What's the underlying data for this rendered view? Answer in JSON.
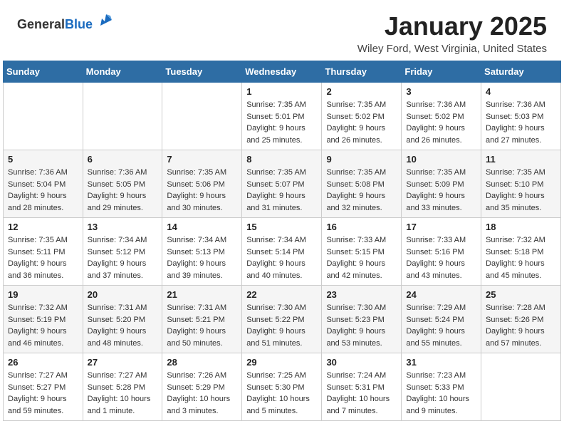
{
  "header": {
    "logo_general": "General",
    "logo_blue": "Blue",
    "title": "January 2025",
    "location": "Wiley Ford, West Virginia, United States"
  },
  "weekdays": [
    "Sunday",
    "Monday",
    "Tuesday",
    "Wednesday",
    "Thursday",
    "Friday",
    "Saturday"
  ],
  "weeks": [
    [
      {
        "day": "",
        "detail": ""
      },
      {
        "day": "",
        "detail": ""
      },
      {
        "day": "",
        "detail": ""
      },
      {
        "day": "1",
        "detail": "Sunrise: 7:35 AM\nSunset: 5:01 PM\nDaylight: 9 hours\nand 25 minutes."
      },
      {
        "day": "2",
        "detail": "Sunrise: 7:35 AM\nSunset: 5:02 PM\nDaylight: 9 hours\nand 26 minutes."
      },
      {
        "day": "3",
        "detail": "Sunrise: 7:36 AM\nSunset: 5:02 PM\nDaylight: 9 hours\nand 26 minutes."
      },
      {
        "day": "4",
        "detail": "Sunrise: 7:36 AM\nSunset: 5:03 PM\nDaylight: 9 hours\nand 27 minutes."
      }
    ],
    [
      {
        "day": "5",
        "detail": "Sunrise: 7:36 AM\nSunset: 5:04 PM\nDaylight: 9 hours\nand 28 minutes."
      },
      {
        "day": "6",
        "detail": "Sunrise: 7:36 AM\nSunset: 5:05 PM\nDaylight: 9 hours\nand 29 minutes."
      },
      {
        "day": "7",
        "detail": "Sunrise: 7:35 AM\nSunset: 5:06 PM\nDaylight: 9 hours\nand 30 minutes."
      },
      {
        "day": "8",
        "detail": "Sunrise: 7:35 AM\nSunset: 5:07 PM\nDaylight: 9 hours\nand 31 minutes."
      },
      {
        "day": "9",
        "detail": "Sunrise: 7:35 AM\nSunset: 5:08 PM\nDaylight: 9 hours\nand 32 minutes."
      },
      {
        "day": "10",
        "detail": "Sunrise: 7:35 AM\nSunset: 5:09 PM\nDaylight: 9 hours\nand 33 minutes."
      },
      {
        "day": "11",
        "detail": "Sunrise: 7:35 AM\nSunset: 5:10 PM\nDaylight: 9 hours\nand 35 minutes."
      }
    ],
    [
      {
        "day": "12",
        "detail": "Sunrise: 7:35 AM\nSunset: 5:11 PM\nDaylight: 9 hours\nand 36 minutes."
      },
      {
        "day": "13",
        "detail": "Sunrise: 7:34 AM\nSunset: 5:12 PM\nDaylight: 9 hours\nand 37 minutes."
      },
      {
        "day": "14",
        "detail": "Sunrise: 7:34 AM\nSunset: 5:13 PM\nDaylight: 9 hours\nand 39 minutes."
      },
      {
        "day": "15",
        "detail": "Sunrise: 7:34 AM\nSunset: 5:14 PM\nDaylight: 9 hours\nand 40 minutes."
      },
      {
        "day": "16",
        "detail": "Sunrise: 7:33 AM\nSunset: 5:15 PM\nDaylight: 9 hours\nand 42 minutes."
      },
      {
        "day": "17",
        "detail": "Sunrise: 7:33 AM\nSunset: 5:16 PM\nDaylight: 9 hours\nand 43 minutes."
      },
      {
        "day": "18",
        "detail": "Sunrise: 7:32 AM\nSunset: 5:18 PM\nDaylight: 9 hours\nand 45 minutes."
      }
    ],
    [
      {
        "day": "19",
        "detail": "Sunrise: 7:32 AM\nSunset: 5:19 PM\nDaylight: 9 hours\nand 46 minutes."
      },
      {
        "day": "20",
        "detail": "Sunrise: 7:31 AM\nSunset: 5:20 PM\nDaylight: 9 hours\nand 48 minutes."
      },
      {
        "day": "21",
        "detail": "Sunrise: 7:31 AM\nSunset: 5:21 PM\nDaylight: 9 hours\nand 50 minutes."
      },
      {
        "day": "22",
        "detail": "Sunrise: 7:30 AM\nSunset: 5:22 PM\nDaylight: 9 hours\nand 51 minutes."
      },
      {
        "day": "23",
        "detail": "Sunrise: 7:30 AM\nSunset: 5:23 PM\nDaylight: 9 hours\nand 53 minutes."
      },
      {
        "day": "24",
        "detail": "Sunrise: 7:29 AM\nSunset: 5:24 PM\nDaylight: 9 hours\nand 55 minutes."
      },
      {
        "day": "25",
        "detail": "Sunrise: 7:28 AM\nSunset: 5:26 PM\nDaylight: 9 hours\nand 57 minutes."
      }
    ],
    [
      {
        "day": "26",
        "detail": "Sunrise: 7:27 AM\nSunset: 5:27 PM\nDaylight: 9 hours\nand 59 minutes."
      },
      {
        "day": "27",
        "detail": "Sunrise: 7:27 AM\nSunset: 5:28 PM\nDaylight: 10 hours\nand 1 minute."
      },
      {
        "day": "28",
        "detail": "Sunrise: 7:26 AM\nSunset: 5:29 PM\nDaylight: 10 hours\nand 3 minutes."
      },
      {
        "day": "29",
        "detail": "Sunrise: 7:25 AM\nSunset: 5:30 PM\nDaylight: 10 hours\nand 5 minutes."
      },
      {
        "day": "30",
        "detail": "Sunrise: 7:24 AM\nSunset: 5:31 PM\nDaylight: 10 hours\nand 7 minutes."
      },
      {
        "day": "31",
        "detail": "Sunrise: 7:23 AM\nSunset: 5:33 PM\nDaylight: 10 hours\nand 9 minutes."
      },
      {
        "day": "",
        "detail": ""
      }
    ]
  ]
}
